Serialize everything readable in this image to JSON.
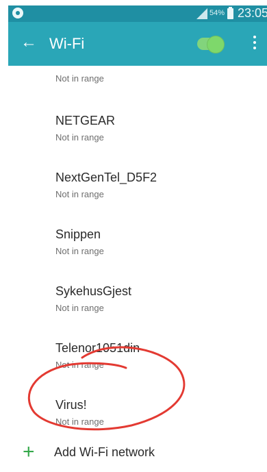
{
  "status_bar": {
    "battery_percent": "54%",
    "time": "23:05"
  },
  "app_bar": {
    "title": "Wi-Fi",
    "back_icon": "arrow-left",
    "wifi_toggle": "on",
    "accent": "#2aa6b7",
    "menu_icon": "more-vertical"
  },
  "networks": [
    {
      "name": "",
      "status": "Not in range"
    },
    {
      "name": "NETGEAR",
      "status": "Not in range"
    },
    {
      "name": "NextGenTel_D5F2",
      "status": "Not in range"
    },
    {
      "name": "Snippen",
      "status": "Not in range"
    },
    {
      "name": "SykehusGjest",
      "status": "Not in range"
    },
    {
      "name": "Telenor1051din",
      "status": "Not in range"
    },
    {
      "name": "Virus!",
      "status": "Not in range"
    }
  ],
  "add_network": {
    "label": "Add Wi-Fi network",
    "icon": "plus"
  },
  "annotation_color": "#e33a32"
}
